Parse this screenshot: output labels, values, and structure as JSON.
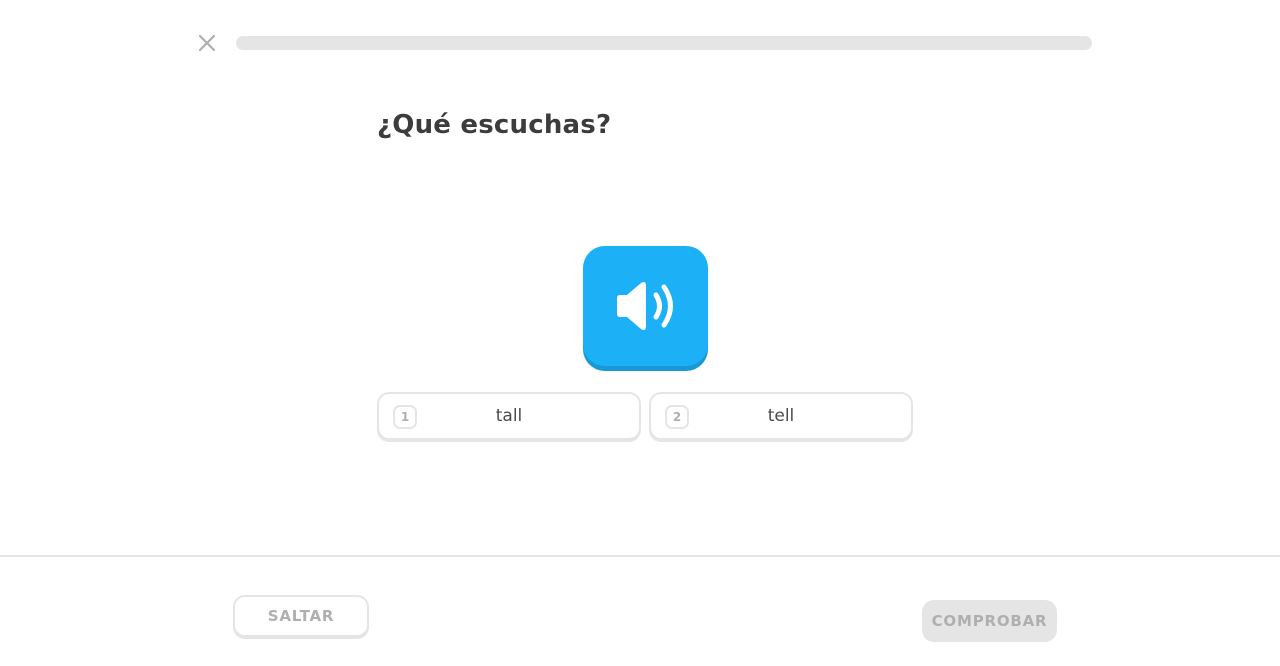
{
  "header": {
    "close_icon": "close-icon",
    "progress_percent": 0
  },
  "prompt": {
    "title": "¿Qué escuchas?"
  },
  "audio": {
    "icon": "speaker-icon",
    "color": "#1cb0f6"
  },
  "choices": [
    {
      "number": "1",
      "label": "tall"
    },
    {
      "number": "2",
      "label": "tell"
    }
  ],
  "footer": {
    "skip_label": "SALTAR",
    "check_label": "COMPROBAR"
  }
}
